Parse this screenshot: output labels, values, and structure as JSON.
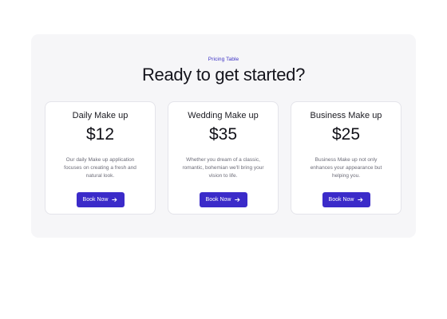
{
  "pricing": {
    "eyebrow": "Pricing Table",
    "headline": "Ready to get started?",
    "accent_color": "#3b2bc9",
    "cards": [
      {
        "title": "Daily Make up",
        "price": "$12",
        "description": "Our daily Make up application focuses on creating a fresh and natural look.",
        "button_label": "Book Now",
        "button_icon": "arrow-right-icon"
      },
      {
        "title": "Wedding Make up",
        "price": "$35",
        "description": "Whether you dream of a classic, romantic, bohemian we'll bring your vision to life.",
        "button_label": "Book Now",
        "button_icon": "arrow-right-icon"
      },
      {
        "title": "Business Make up",
        "price": "$25",
        "description": "Business Make up not only enhances your appearance but helping you.",
        "button_label": "Book Now",
        "button_icon": "arrow-right-icon"
      }
    ]
  }
}
